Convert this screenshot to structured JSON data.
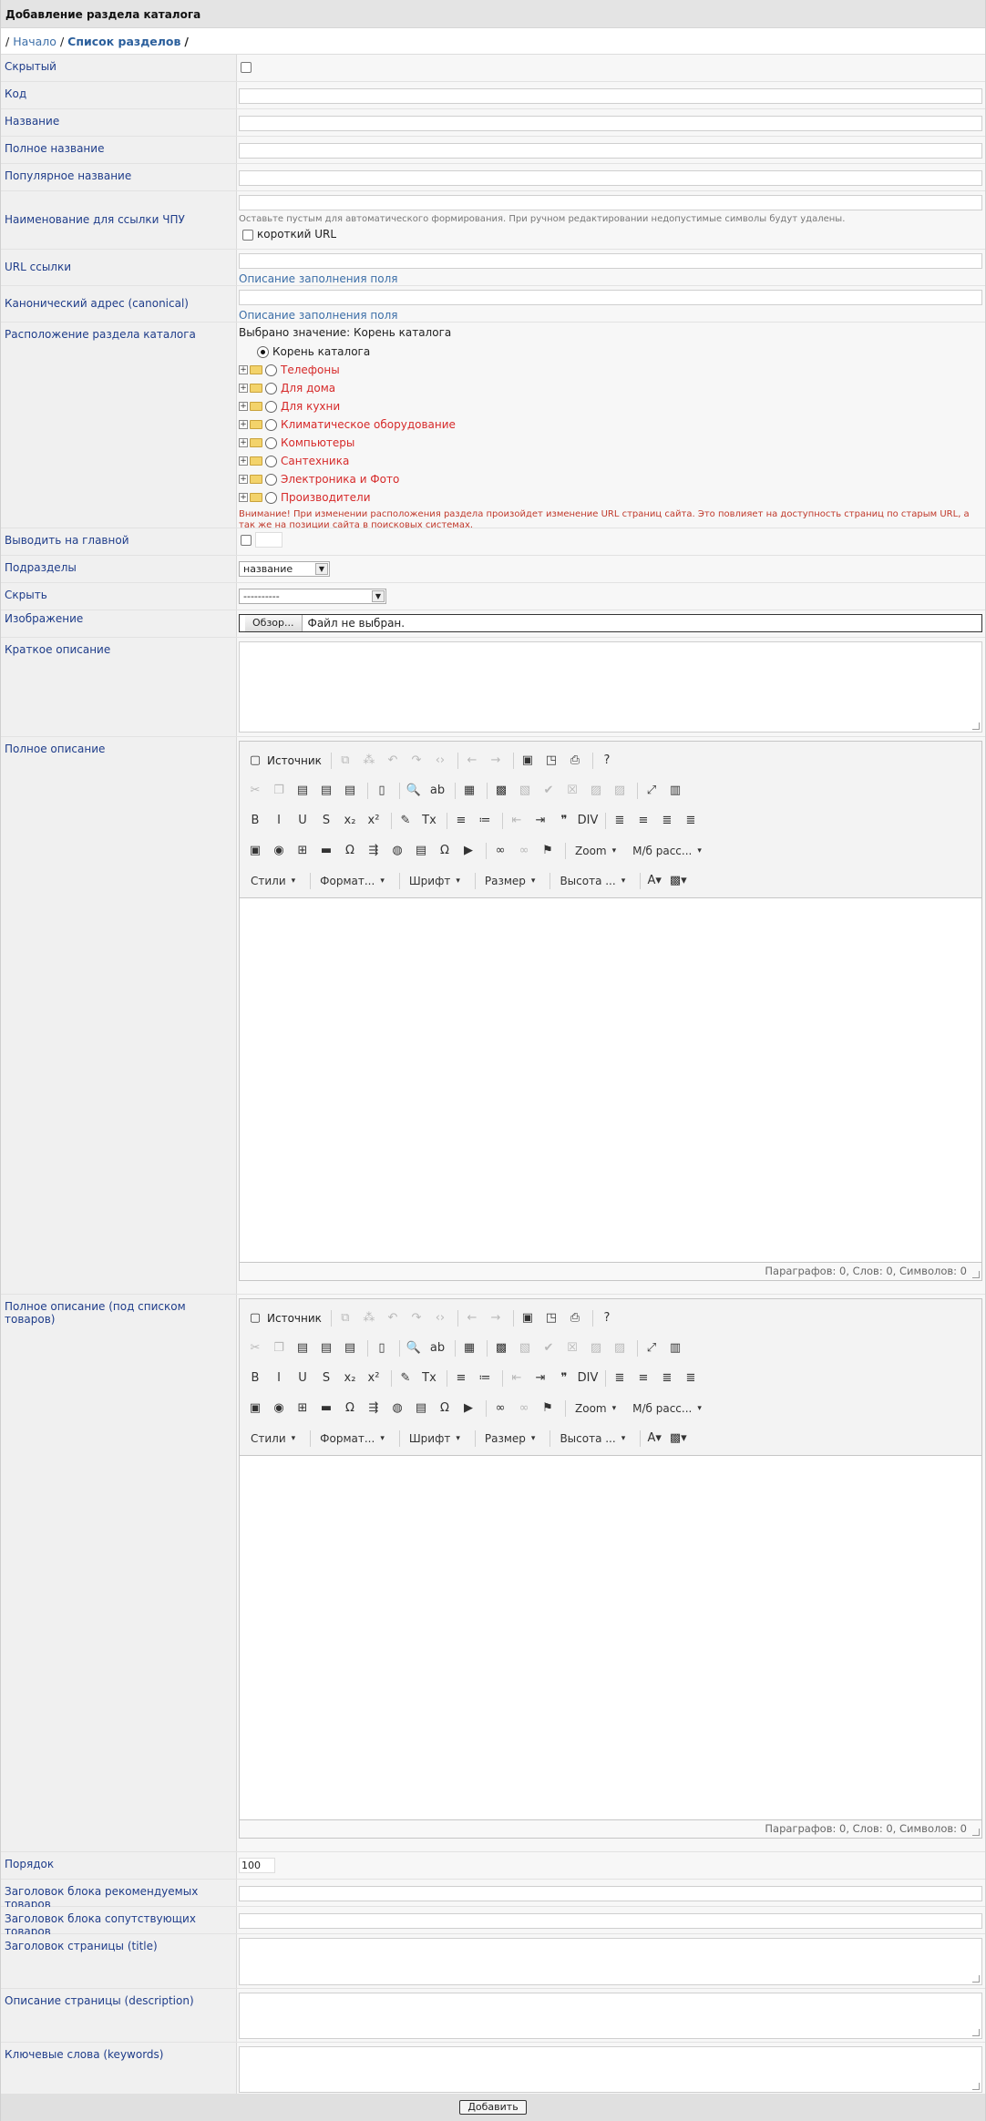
{
  "header": {
    "title": "Добавление раздела каталога"
  },
  "breadcrumb": {
    "home": "Начало",
    "sep": "/",
    "list": "Список разделов"
  },
  "fields": {
    "hidden": "Скрытый",
    "code": "Код",
    "name": "Название",
    "full_name": "Полное название",
    "popular_name": "Популярное название",
    "chpu": "Наименование для ссылки ЧПУ",
    "chpu_hint": "Оставьте пустым для автоматического формирования. При ручном редактировании недопустимые символы будут удалены.",
    "short_url": "короткий URL",
    "url": "URL ссылки",
    "url_link": "Описание заполнения поля",
    "canonical": "Канонический адрес (canonical)",
    "canonical_link": "Описание заполнения поля",
    "location": "Расположение раздела каталога",
    "location_selected": "Выбрано значение: Корень каталога",
    "root": "Корень каталога",
    "tree": [
      "Телефоны",
      "Для дома",
      "Для кухни",
      "Климатическое оборудование",
      "Компьютеры",
      "Сантехника",
      "Электроника и Фото",
      "Производители"
    ],
    "location_warning": "Внимание! При изменении расположения раздела произойдет изменение URL страниц сайта. Это повлияет на доступность страниц по старым URL, а так же на позиции сайта в поисковых системах.",
    "show_main": "Выводить на главной",
    "subsections": "Подразделы",
    "subsections_value": "название",
    "hide": "Скрыть",
    "hide_value": "----------",
    "image": "Изображение",
    "browse": "Обзор...",
    "no_file": "Файл не выбран.",
    "short_desc": "Краткое описание",
    "full_desc": "Полное описание",
    "full_desc_under": "Полное описание (под списком товаров)",
    "order": "Порядок",
    "order_value": "100",
    "rec_title": "Заголовок блока рекомендуемых товаров",
    "rel_title": "Заголовок блока сопутствующих товаров",
    "page_title": "Заголовок страницы (title)",
    "page_desc": "Описание страницы (description)",
    "keywords": "Ключевые слова (keywords)"
  },
  "editor": {
    "source": "Источник",
    "zoom": "Zoom",
    "spacing": "М/б расс...",
    "styles": "Стили",
    "format": "Формат...",
    "font": "Шрифт",
    "size": "Размер",
    "height": "Высота ...",
    "status": "Параграфов: 0, Слов: 0, Символов: 0"
  },
  "submit": "Добавить"
}
